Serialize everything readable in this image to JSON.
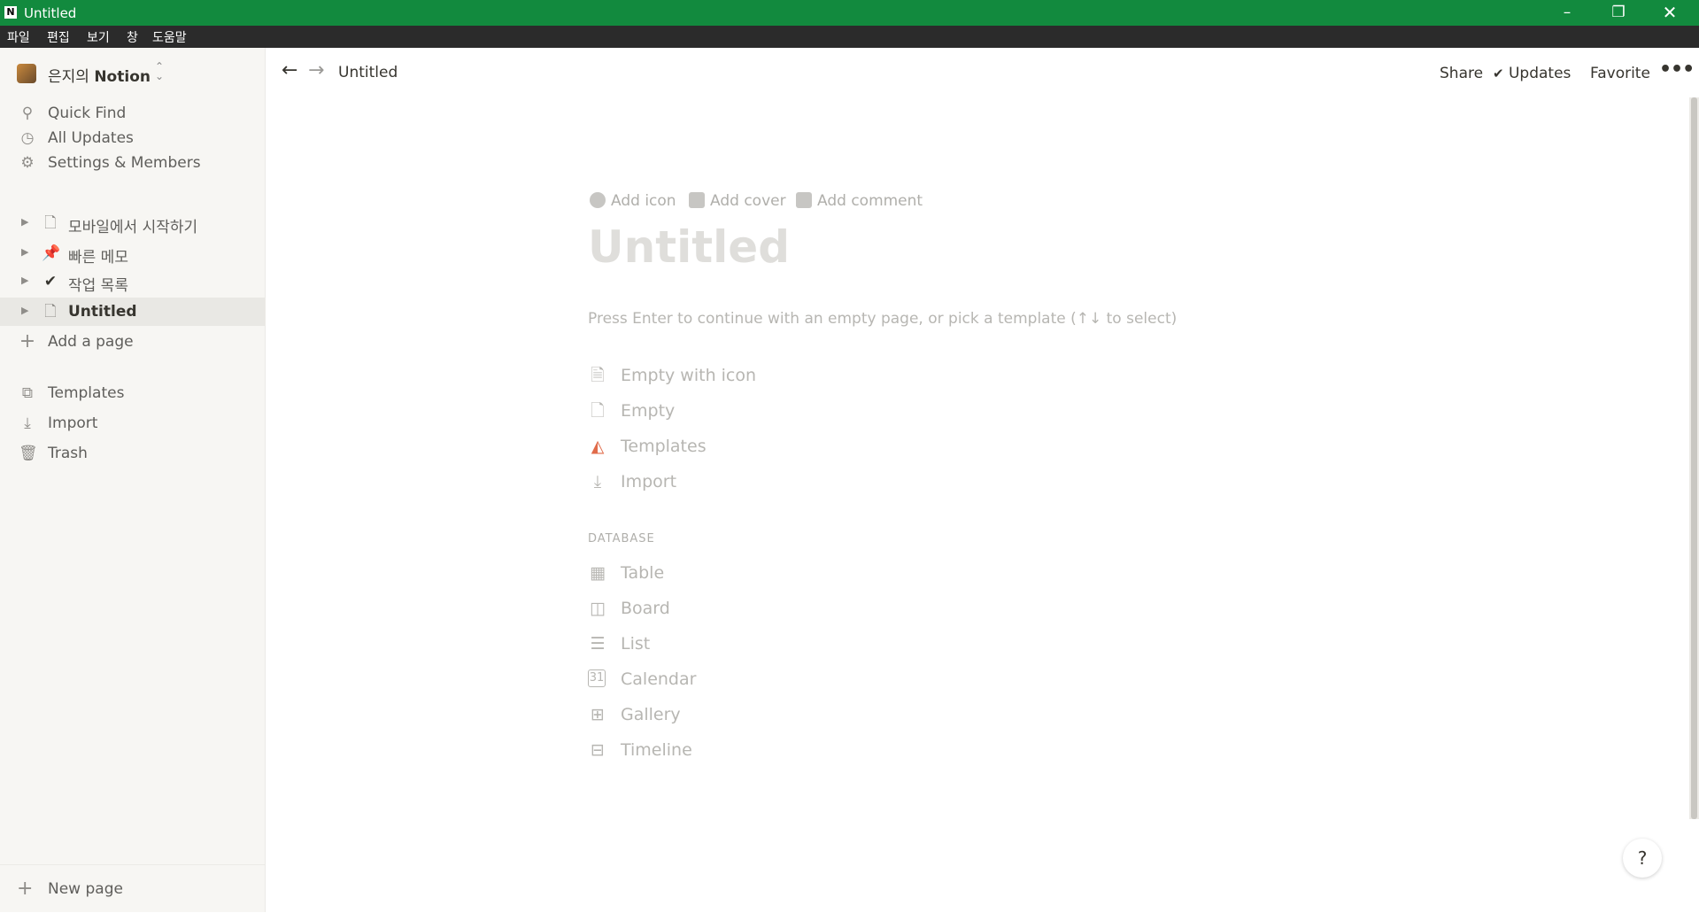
{
  "window": {
    "title": "Untitled",
    "min_label": "–",
    "max_label": "❐",
    "close_label": "✕"
  },
  "menu": [
    "파일",
    "편집",
    "보기",
    "창",
    "도움말"
  ],
  "sidebar": {
    "workspace_prefix": "은지의",
    "workspace_name": "Notion",
    "top_items": [
      {
        "label": "Quick Find",
        "icon": "search-icon"
      },
      {
        "label": "All Updates",
        "icon": "clock-icon"
      },
      {
        "label": "Settings & Members",
        "icon": "gear-icon"
      }
    ],
    "pages": [
      {
        "label": "모바일에서 시작하기",
        "icon": "page-icon"
      },
      {
        "label": "빠른 메모",
        "icon": "pushpin-icon"
      },
      {
        "label": "작업 목록",
        "icon": "checkmark-icon"
      },
      {
        "label": "Untitled",
        "icon": "page-icon",
        "selected": true
      }
    ],
    "add_page": "Add a page",
    "bottom_items": [
      {
        "label": "Templates",
        "icon": "templates-icon"
      },
      {
        "label": "Import",
        "icon": "import-icon"
      },
      {
        "label": "Trash",
        "icon": "trash-icon"
      }
    ],
    "new_page": "New page"
  },
  "topbar": {
    "breadcrumb": "Untitled",
    "share": "Share",
    "updates": "Updates",
    "favorite": "Favorite",
    "more": "•••"
  },
  "page": {
    "add_icon": "Add icon",
    "add_cover": "Add cover",
    "add_comment": "Add comment",
    "title_placeholder": "Untitled",
    "hint": "Press Enter to continue with an empty page, or pick a template (↑↓ to select)",
    "options": [
      {
        "label": "Empty with icon",
        "icon": "page-lines-icon"
      },
      {
        "label": "Empty",
        "icon": "page-icon"
      },
      {
        "label": "Templates",
        "icon": "templates-icon"
      },
      {
        "label": "Import",
        "icon": "import-icon"
      }
    ],
    "database_label": "DATABASE",
    "database_options": [
      {
        "label": "Table",
        "icon": "table-icon"
      },
      {
        "label": "Board",
        "icon": "board-icon"
      },
      {
        "label": "List",
        "icon": "list-icon"
      },
      {
        "label": "Calendar",
        "icon": "calendar-icon"
      },
      {
        "label": "Gallery",
        "icon": "gallery-icon"
      },
      {
        "label": "Timeline",
        "icon": "timeline-icon"
      }
    ]
  },
  "help": "?",
  "colors": {
    "titlebar": "#128a3e",
    "menubar": "#2b2b2b",
    "sidebar": "#f7f6f3",
    "text": "#37352f"
  }
}
